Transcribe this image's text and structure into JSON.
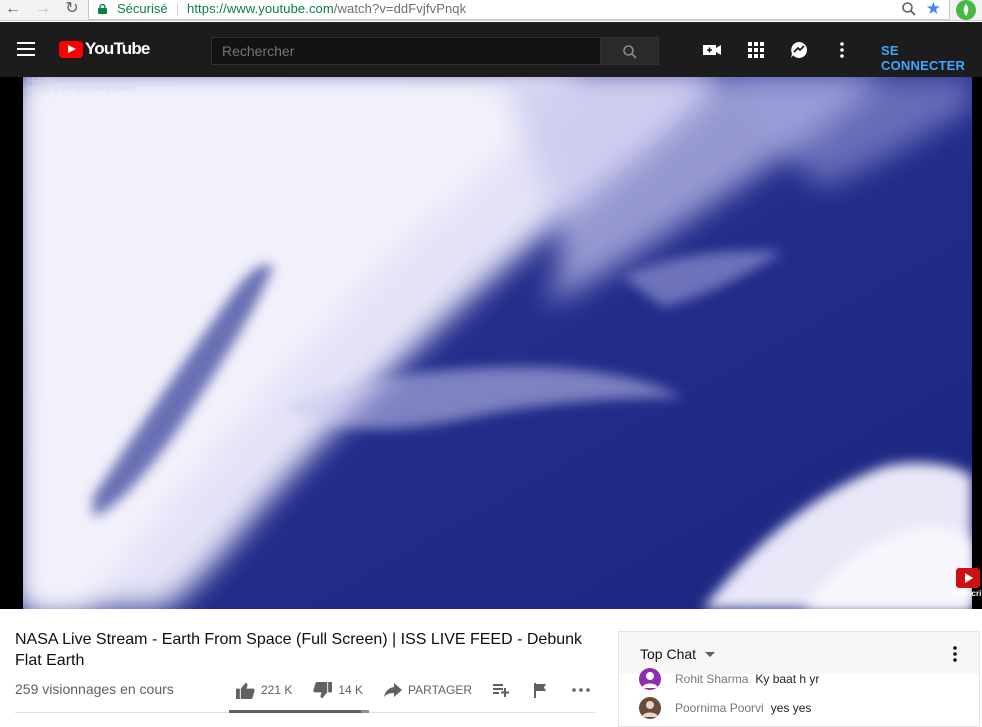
{
  "browser": {
    "secure_label": "Sécurisé",
    "url_host": "https://www.youtube.com",
    "url_path": "/watch?v=ddFvjfvPnqk"
  },
  "masthead": {
    "logo_text": "YouTube",
    "search_placeholder": "Rechercher",
    "signin_label": "SE CONNECTER"
  },
  "player": {
    "watermark_line1": "I-EARTH",
    "watermark_line2": "Brought to you by AmazingSpace2",
    "subscribe_label": "Subscribe"
  },
  "video": {
    "title": "NASA Live Stream - Earth From Space (Full Screen) | ISS LIVE FEED - Debunk Flat Earth",
    "views": "259 visionnages en cours",
    "likes": "221 K",
    "dislikes": "14 K",
    "share_label": "PARTAGER",
    "like_ratio": 0.94
  },
  "chat": {
    "header": "Top Chat",
    "messages": [
      {
        "author": "Rohit Sharma",
        "text": "Ky baat h yr",
        "avatar_color": "#8e2db0"
      },
      {
        "author": "Poornima Poorvi",
        "text": "yes yes",
        "avatar_color": "#6a4a3a"
      }
    ]
  },
  "colors": {
    "accent_link": "#3ea6ff",
    "secure_green": "#0b8043",
    "brand_red": "#ff0000",
    "masthead_bg": "#1c1c1c"
  }
}
